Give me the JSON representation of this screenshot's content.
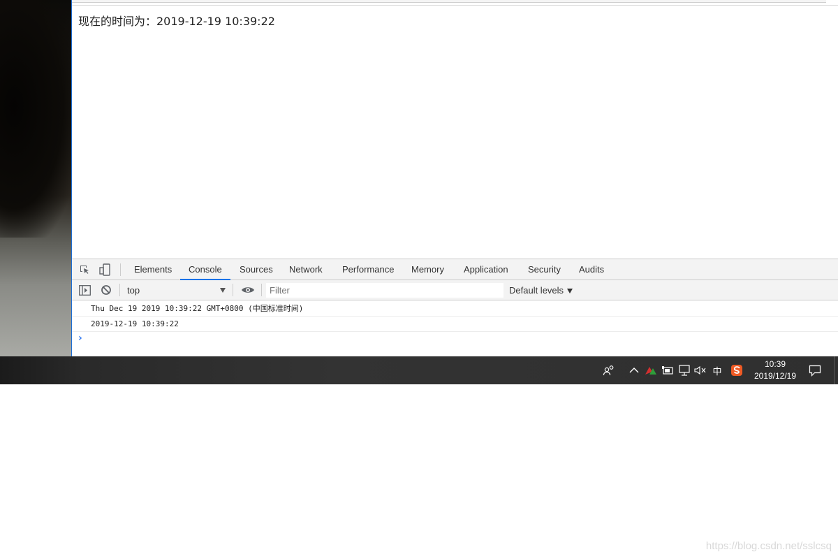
{
  "page": {
    "body_text": "现在的时间为：2019-12-19 10:39:22"
  },
  "devtools": {
    "tabs": [
      {
        "label": "Elements",
        "active": false
      },
      {
        "label": "Console",
        "active": true
      },
      {
        "label": "Sources",
        "active": false
      },
      {
        "label": "Network",
        "active": false
      },
      {
        "label": "Performance",
        "active": false
      },
      {
        "label": "Memory",
        "active": false
      },
      {
        "label": "Application",
        "active": false
      },
      {
        "label": "Security",
        "active": false
      },
      {
        "label": "Audits",
        "active": false
      }
    ],
    "toolbar": {
      "context": "top",
      "filter_placeholder": "Filter",
      "levels_label": "Default levels"
    },
    "console_lines": [
      "Thu Dec 19 2019 10:39:22 GMT+0800 (中国标准时间)",
      "2019-12-19 10:39:22"
    ],
    "prompt": "›",
    "accent_color": "#1a73e8"
  },
  "taskbar": {
    "ime_label": "中",
    "clock_time": "10:39",
    "clock_date": "2019/12/19",
    "icons": [
      "people-icon",
      "chevron-up-icon",
      "app-tray-icon",
      "battery-icon",
      "network-icon",
      "volume-muted-icon",
      "ime-icon",
      "sogou-input-icon",
      "notification-icon"
    ]
  },
  "watermark": "https://blog.csdn.net/sslcsq"
}
